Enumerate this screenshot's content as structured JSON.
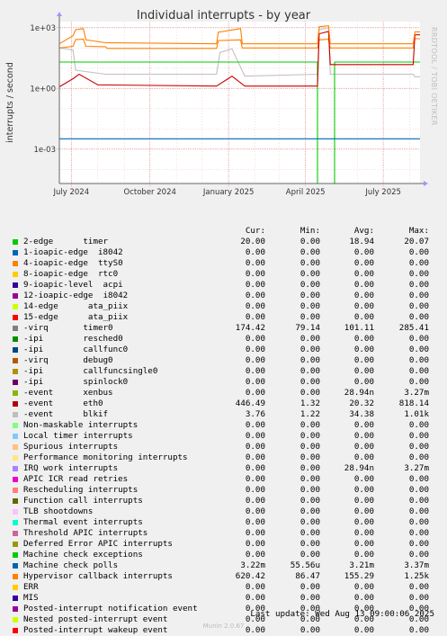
{
  "chart_data": {
    "type": "line",
    "title": "Individual interrupts - by year",
    "ylabel": "interrupts / second",
    "y_scale": "log",
    "ylim": [
      2e-05,
      2000
    ],
    "y_ticks": [
      {
        "value": 1000,
        "label": "1e+03"
      },
      {
        "value": 1,
        "label": "1e+00"
      },
      {
        "value": 0.001,
        "label": "1e-03"
      }
    ],
    "x_range": [
      "2024-06-17",
      "2025-08-13"
    ],
    "x_ticks": [
      {
        "date": "2024-07-01",
        "label": "July 2024"
      },
      {
        "date": "2024-10-01",
        "label": "October 2024"
      },
      {
        "date": "2025-01-01",
        "label": "January 2025"
      },
      {
        "date": "2025-04-01",
        "label": "April 2025"
      },
      {
        "date": "2025-07-01",
        "label": "July 2025"
      }
    ],
    "grid": true,
    "series": [
      {
        "name": "2-edge      timer",
        "color": "#00cc00",
        "points": [
          [
            "2024-06-17",
            20.0
          ],
          [
            "2025-04-15",
            20.0
          ],
          [
            "2025-04-15",
            2e-05
          ],
          [
            "2025-05-05",
            2e-05
          ],
          [
            "2025-05-05",
            20.07
          ],
          [
            "2025-08-13",
            20.07
          ]
        ]
      },
      {
        "name": "-virq       timer0",
        "color": "#ff8000",
        "points": [
          [
            "2024-06-17",
            100
          ],
          [
            "2024-07-03",
            120
          ],
          [
            "2024-07-06",
            260
          ],
          [
            "2024-07-15",
            270
          ],
          [
            "2024-07-18",
            120
          ],
          [
            "2024-08-10",
            115
          ],
          [
            "2024-08-12",
            95
          ],
          [
            "2024-12-18",
            95
          ],
          [
            "2024-12-20",
            230
          ],
          [
            "2025-01-15",
            250
          ],
          [
            "2025-01-17",
            100
          ],
          [
            "2025-04-15",
            100
          ],
          [
            "2025-04-17",
            250
          ],
          [
            "2025-04-28",
            270
          ],
          [
            "2025-04-30",
            100
          ],
          [
            "2025-08-05",
            100
          ],
          [
            "2025-08-07",
            285
          ],
          [
            "2025-08-13",
            285
          ]
        ]
      },
      {
        "name": "-event      eth0",
        "color": "#cc0000",
        "points": [
          [
            "2024-06-17",
            1.2
          ],
          [
            "2024-07-03",
            3
          ],
          [
            "2024-07-10",
            5
          ],
          [
            "2024-08-01",
            1.5
          ],
          [
            "2024-12-18",
            1.3
          ],
          [
            "2025-01-05",
            4
          ],
          [
            "2025-01-20",
            1.3
          ],
          [
            "2025-04-15",
            1.3
          ],
          [
            "2025-04-17",
            500
          ],
          [
            "2025-04-28",
            650
          ],
          [
            "2025-04-30",
            15
          ],
          [
            "2025-08-05",
            15
          ],
          [
            "2025-08-07",
            446.49
          ],
          [
            "2025-08-13",
            446.49
          ]
        ]
      },
      {
        "name": "-event      blkif",
        "color": "#c0c0c0",
        "points": [
          [
            "2024-06-17",
            100
          ],
          [
            "2024-07-03",
            80
          ],
          [
            "2024-07-06",
            8
          ],
          [
            "2024-08-10",
            5
          ],
          [
            "2024-12-18",
            5
          ],
          [
            "2024-12-22",
            60
          ],
          [
            "2025-01-05",
            90
          ],
          [
            "2025-01-20",
            4
          ],
          [
            "2025-04-15",
            5
          ],
          [
            "2025-04-17",
            800
          ],
          [
            "2025-04-28",
            1000
          ],
          [
            "2025-04-30",
            5
          ],
          [
            "2025-08-05",
            5
          ],
          [
            "2025-08-07",
            3.76
          ],
          [
            "2025-08-13",
            3.76
          ]
        ]
      },
      {
        "name": "Machine check polls",
        "color": "#0066b3",
        "points": [
          [
            "2024-06-17",
            0.00322
          ],
          [
            "2025-08-13",
            0.00322
          ]
        ]
      },
      {
        "name": "Hypervisor callback interrupts",
        "color": "#ff8000",
        "points": [
          [
            "2024-06-17",
            160
          ],
          [
            "2024-07-03",
            400
          ],
          [
            "2024-07-06",
            800
          ],
          [
            "2024-07-15",
            900
          ],
          [
            "2024-07-18",
            250
          ],
          [
            "2024-08-10",
            180
          ],
          [
            "2024-12-18",
            160
          ],
          [
            "2024-12-20",
            600
          ],
          [
            "2025-01-15",
            900
          ],
          [
            "2025-01-17",
            160
          ],
          [
            "2025-04-15",
            160
          ],
          [
            "2025-04-17",
            1100
          ],
          [
            "2025-04-28",
            1250
          ],
          [
            "2025-04-30",
            160
          ],
          [
            "2025-08-05",
            160
          ],
          [
            "2025-08-07",
            620.42
          ],
          [
            "2025-08-13",
            620.42
          ]
        ]
      }
    ],
    "legend": {
      "headers": {
        "cur": "Cur:",
        "min": "Min:",
        "avg": "Avg:",
        "max": "Max:"
      },
      "rows": [
        {
          "label": "2-edge      timer",
          "color": "#00cc00",
          "cur": "20.00",
          "min": "0.00",
          "avg": "18.94",
          "max": "20.07"
        },
        {
          "label": "1-ioapic-edge  i8042",
          "color": "#0066b3",
          "cur": "0.00",
          "min": "0.00",
          "avg": "0.00",
          "max": "0.00"
        },
        {
          "label": "4-ioapic-edge  ttyS0",
          "color": "#ff8000",
          "cur": "0.00",
          "min": "0.00",
          "avg": "0.00",
          "max": "0.00"
        },
        {
          "label": "8-ioapic-edge  rtc0",
          "color": "#ffcc00",
          "cur": "0.00",
          "min": "0.00",
          "avg": "0.00",
          "max": "0.00"
        },
        {
          "label": "9-ioapic-level  acpi",
          "color": "#330099",
          "cur": "0.00",
          "min": "0.00",
          "avg": "0.00",
          "max": "0.00"
        },
        {
          "label": "12-ioapic-edge  i8042",
          "color": "#990099",
          "cur": "0.00",
          "min": "0.00",
          "avg": "0.00",
          "max": "0.00"
        },
        {
          "label": "14-edge      ata_piix",
          "color": "#ccff00",
          "cur": "0.00",
          "min": "0.00",
          "avg": "0.00",
          "max": "0.00"
        },
        {
          "label": "15-edge      ata_piix",
          "color": "#ff0000",
          "cur": "0.00",
          "min": "0.00",
          "avg": "0.00",
          "max": "0.00"
        },
        {
          "label": "-virq       timer0",
          "color": "#808080",
          "cur": "174.42",
          "min": "79.14",
          "avg": "101.11",
          "max": "285.41"
        },
        {
          "label": "-ipi        resched0",
          "color": "#008f00",
          "cur": "0.00",
          "min": "0.00",
          "avg": "0.00",
          "max": "0.00"
        },
        {
          "label": "-ipi        callfunc0",
          "color": "#00487d",
          "cur": "0.00",
          "min": "0.00",
          "avg": "0.00",
          "max": "0.00"
        },
        {
          "label": "-virq       debug0",
          "color": "#b35a00",
          "cur": "0.00",
          "min": "0.00",
          "avg": "0.00",
          "max": "0.00"
        },
        {
          "label": "-ipi        callfuncsingle0",
          "color": "#b38f00",
          "cur": "0.00",
          "min": "0.00",
          "avg": "0.00",
          "max": "0.00"
        },
        {
          "label": "-ipi        spinlock0",
          "color": "#6b006b",
          "cur": "0.00",
          "min": "0.00",
          "avg": "0.00",
          "max": "0.00"
        },
        {
          "label": "-event      xenbus",
          "color": "#8fb300",
          "cur": "0.00",
          "min": "0.00",
          "avg": "28.94n",
          "max": "3.27m"
        },
        {
          "label": "-event      eth0",
          "color": "#b30000",
          "cur": "446.49",
          "min": "1.32",
          "avg": "20.32",
          "max": "818.14"
        },
        {
          "label": "-event      blkif",
          "color": "#bebebe",
          "cur": "3.76",
          "min": "1.22",
          "avg": "34.38",
          "max": "1.01k"
        },
        {
          "label": "Non-maskable interrupts",
          "color": "#80ff80",
          "cur": "0.00",
          "min": "0.00",
          "avg": "0.00",
          "max": "0.00"
        },
        {
          "label": "Local timer interrupts",
          "color": "#80c9ff",
          "cur": "0.00",
          "min": "0.00",
          "avg": "0.00",
          "max": "0.00"
        },
        {
          "label": "Spurious interrupts",
          "color": "#ffc080",
          "cur": "0.00",
          "min": "0.00",
          "avg": "0.00",
          "max": "0.00"
        },
        {
          "label": "Performance monitoring interrupts",
          "color": "#ffe680",
          "cur": "0.00",
          "min": "0.00",
          "avg": "0.00",
          "max": "0.00"
        },
        {
          "label": "IRQ work interrupts",
          "color": "#aa80ff",
          "cur": "0.00",
          "min": "0.00",
          "avg": "28.94n",
          "max": "3.27m"
        },
        {
          "label": "APIC ICR read retries",
          "color": "#ee00cc",
          "cur": "0.00",
          "min": "0.00",
          "avg": "0.00",
          "max": "0.00"
        },
        {
          "label": "Rescheduling interrupts",
          "color": "#ff8080",
          "cur": "0.00",
          "min": "0.00",
          "avg": "0.00",
          "max": "0.00"
        },
        {
          "label": "Function call interrupts",
          "color": "#666600",
          "cur": "0.00",
          "min": "0.00",
          "avg": "0.00",
          "max": "0.00"
        },
        {
          "label": "TLB shootdowns",
          "color": "#ffbfff",
          "cur": "0.00",
          "min": "0.00",
          "avg": "0.00",
          "max": "0.00"
        },
        {
          "label": "Thermal event interrupts",
          "color": "#00ffcc",
          "cur": "0.00",
          "min": "0.00",
          "avg": "0.00",
          "max": "0.00"
        },
        {
          "label": "Threshold APIC interrupts",
          "color": "#cc6699",
          "cur": "0.00",
          "min": "0.00",
          "avg": "0.00",
          "max": "0.00"
        },
        {
          "label": "Deferred Error APIC interrupts",
          "color": "#999900",
          "cur": "0.00",
          "min": "0.00",
          "avg": "0.00",
          "max": "0.00"
        },
        {
          "label": "Machine check exceptions",
          "color": "#00cc00",
          "cur": "0.00",
          "min": "0.00",
          "avg": "0.00",
          "max": "0.00"
        },
        {
          "label": "Machine check polls",
          "color": "#0066b3",
          "cur": "3.22m",
          "min": "55.56u",
          "avg": "3.21m",
          "max": "3.37m"
        },
        {
          "label": "Hypervisor callback interrupts",
          "color": "#ff8000",
          "cur": "620.42",
          "min": "86.47",
          "avg": "155.29",
          "max": "1.25k"
        },
        {
          "label": "ERR",
          "color": "#ffcc00",
          "cur": "0.00",
          "min": "0.00",
          "avg": "0.00",
          "max": "0.00"
        },
        {
          "label": "MIS",
          "color": "#330099",
          "cur": "0.00",
          "min": "0.00",
          "avg": "0.00",
          "max": "0.00"
        },
        {
          "label": "Posted-interrupt notification event",
          "color": "#990099",
          "cur": "0.00",
          "min": "0.00",
          "avg": "0.00",
          "max": "0.00"
        },
        {
          "label": "Nested posted-interrupt event",
          "color": "#ccff00",
          "cur": "0.00",
          "min": "0.00",
          "avg": "0.00",
          "max": "0.00"
        },
        {
          "label": "Posted-interrupt wakeup event",
          "color": "#ff0000",
          "cur": "0.00",
          "min": "0.00",
          "avg": "0.00",
          "max": "0.00"
        }
      ]
    }
  },
  "side_label": "RRDTOOL / TOBI OETIKER",
  "last_update": "Last update: Wed Aug 13 09:00:06 2025",
  "footer": "Munin 2.0.67"
}
